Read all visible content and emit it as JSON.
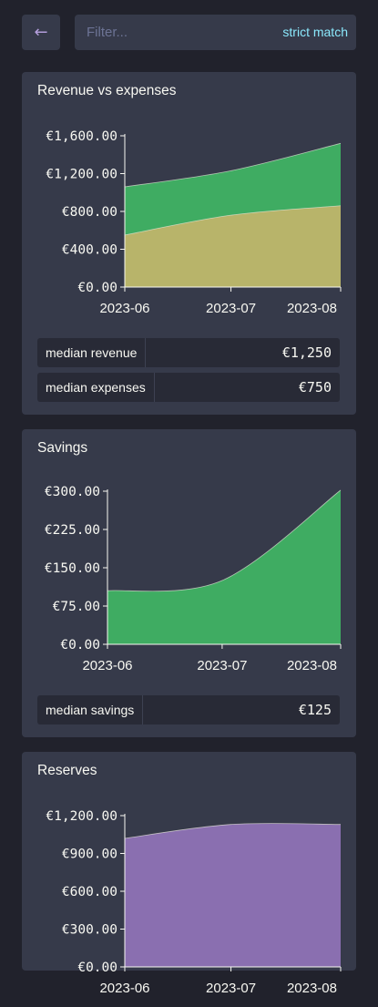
{
  "toolbar": {
    "back_icon": "←",
    "filter_placeholder": "Filter...",
    "strict_label": "strict match"
  },
  "colors": {
    "revenue": "#3fac62",
    "expenses": "#b8b46a",
    "savings": "#3fac62",
    "reserves": "#8a6fb0"
  },
  "chart_data": [
    {
      "type": "area",
      "title": "Revenue vs expenses",
      "x": [
        "2023-06-01",
        "2023-07-01",
        "2023-08-01"
      ],
      "xticks": [
        "2023-06",
        "2023-07",
        "2023-08"
      ],
      "yticks": [
        "€0.00",
        "€400.00",
        "€800.00",
        "€1,200.00",
        "€1,600.00"
      ],
      "ylim": [
        0,
        1600
      ],
      "series": [
        {
          "name": "revenue",
          "values": [
            1060,
            1230,
            1520
          ]
        },
        {
          "name": "expenses",
          "values": [
            550,
            760,
            860
          ]
        }
      ],
      "stats": [
        {
          "label": "median revenue",
          "value": "€1,250"
        },
        {
          "label": "median expenses",
          "value": "€750"
        }
      ]
    },
    {
      "type": "area",
      "title": "Savings",
      "x": [
        "2023-06-01",
        "2023-07-01",
        "2023-08-01"
      ],
      "xticks": [
        "2023-06",
        "2023-07",
        "2023-08"
      ],
      "yticks": [
        "€0.00",
        "€75.00",
        "€150.00",
        "€225.00",
        "€300.00"
      ],
      "ylim": [
        0,
        300
      ],
      "series": [
        {
          "name": "savings",
          "values": [
            105,
            125,
            302
          ]
        }
      ],
      "stats": [
        {
          "label": "median savings",
          "value": "€125"
        }
      ]
    },
    {
      "type": "area",
      "title": "Reserves",
      "x": [
        "2023-06-01",
        "2023-07-01",
        "2023-08-01"
      ],
      "xticks": [
        "2023-06",
        "2023-07",
        "2023-08"
      ],
      "yticks": [
        "€0.00",
        "€300.00",
        "€600.00",
        "€900.00",
        "€1,200.00"
      ],
      "ylim": [
        0,
        1200
      ],
      "series": [
        {
          "name": "reserves",
          "values": [
            1020,
            1130,
            1130
          ]
        }
      ],
      "stats": []
    }
  ]
}
